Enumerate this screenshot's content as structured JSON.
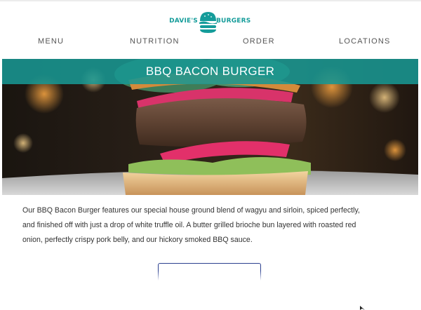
{
  "brand": {
    "left": "DAVIE'S",
    "right": "BURGERS",
    "color": "#159c9a"
  },
  "nav": {
    "items": [
      {
        "label": "MENU"
      },
      {
        "label": "NUTRITION"
      },
      {
        "label": "ORDER"
      },
      {
        "label": "LOCATIONS"
      }
    ]
  },
  "hero": {
    "title": "BBQ BACON BURGER",
    "band_color": "#189692"
  },
  "description": {
    "lines": [
      "Our BBQ Bacon Burger features our special house ground blend of wagyu and sirloin, spiced perfectly,",
      "and finished off with just a drop of white truffle oil. A butter grilled brioche bun layered with roasted red",
      "onion, perfectly crispy pork belly, and our hickory smoked BBQ sauce."
    ]
  },
  "cta": {
    "label": "",
    "border_color": "#2b3f8f"
  }
}
